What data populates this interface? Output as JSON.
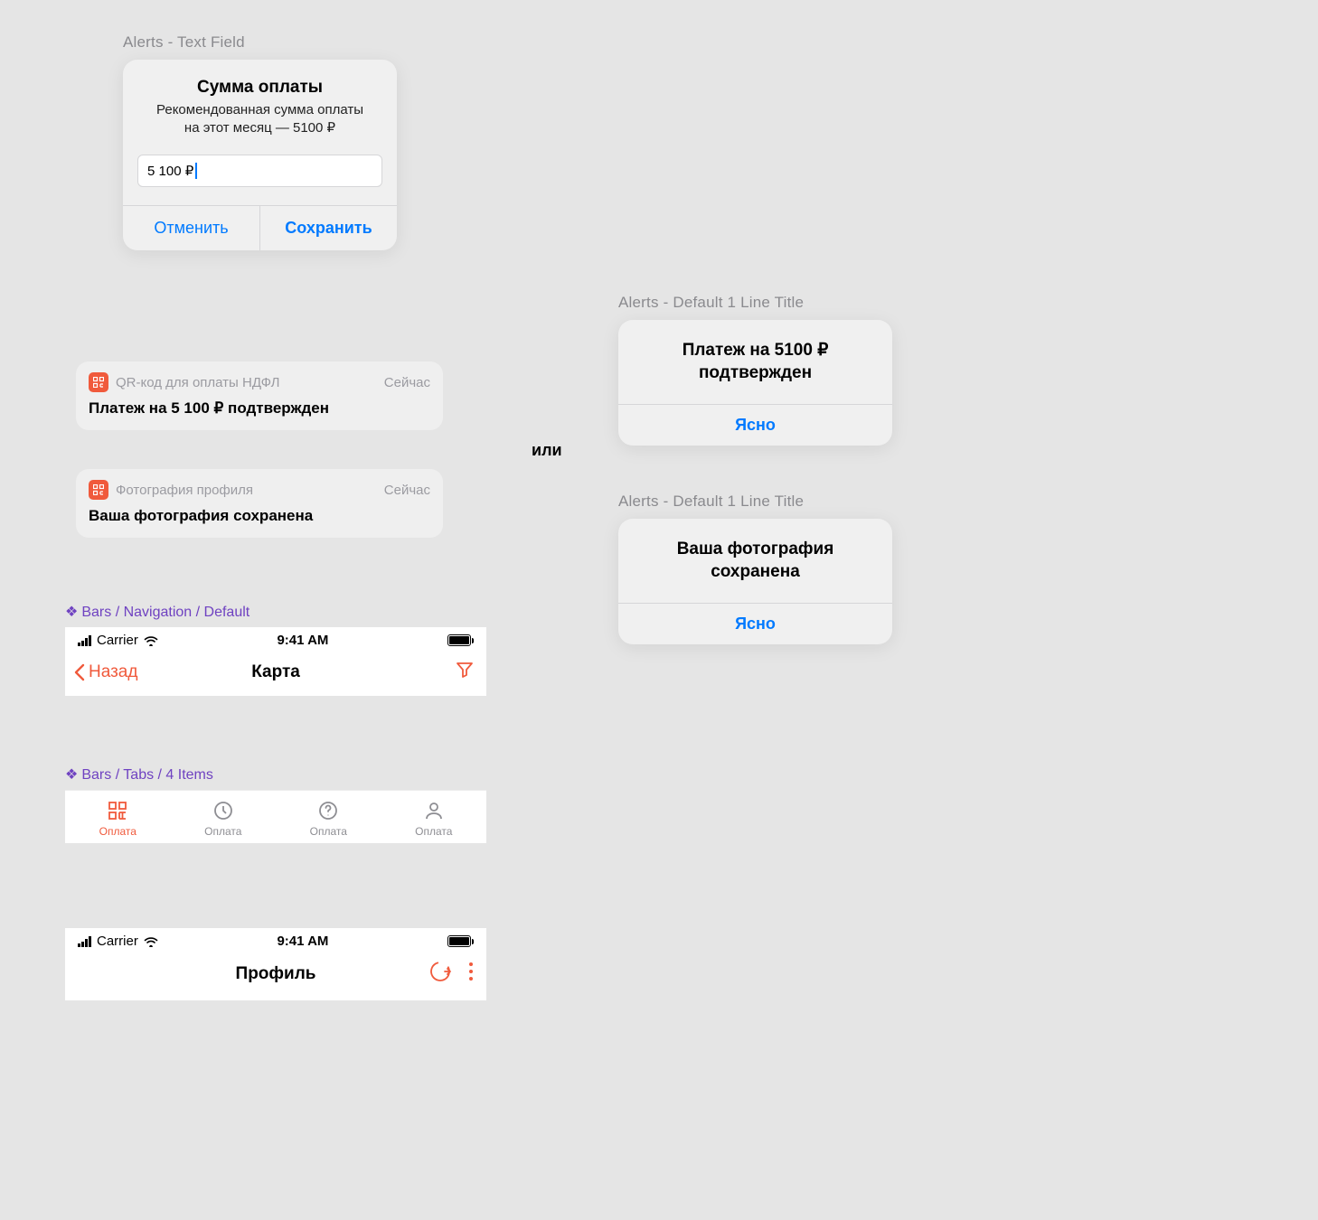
{
  "labels": {
    "alerts_textfield": "Alerts - Text Field",
    "alerts_default_1": "Alerts - Default 1 Line Title",
    "alerts_default_2": "Alerts - Default 1 Line Title",
    "bars_nav": "Bars / Navigation / Default",
    "bars_tabs": "Bars / Tabs / 4 Items",
    "or": "или",
    "diamond": "❖"
  },
  "alert_tf": {
    "title": "Сумма оплаты",
    "subtitle_l1": "Рекомендованная сумма оплаты",
    "subtitle_l2": "на этот месяц — 5100 ₽",
    "input_value": "5 100 ₽",
    "cancel": "Отменить",
    "save": "Сохранить"
  },
  "notif1": {
    "source": "QR-код для оплаты НДФЛ",
    "time": "Сейчас",
    "body": "Платеж на 5 100 ₽ подтвержден"
  },
  "notif2": {
    "source": "Фотография профиля",
    "time": "Сейчас",
    "body": "Ваша фотография сохранена"
  },
  "alert1": {
    "title_l1": "Платеж на 5100 ₽",
    "title_l2": "подтвержден",
    "button": "Ясно"
  },
  "alert2": {
    "title_l1": "Ваша фотография",
    "title_l2": "сохранена",
    "button": "Ясно"
  },
  "status": {
    "carrier": "Carrier",
    "time": "9:41 AM"
  },
  "nav": {
    "back": "Назад",
    "title": "Карта"
  },
  "tabs": {
    "0": "Оплата",
    "1": "Оплата",
    "2": "Оплата",
    "3": "Оплата"
  },
  "profile": {
    "title": "Профиль"
  }
}
